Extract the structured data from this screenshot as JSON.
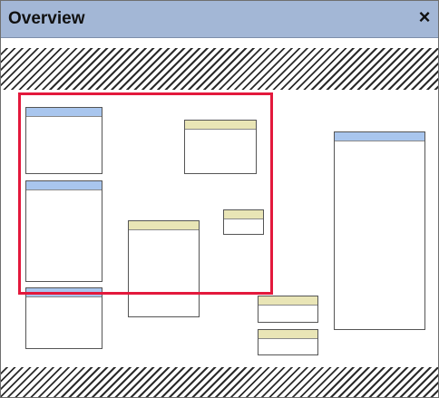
{
  "window": {
    "title": "Overview",
    "close_label": "×"
  },
  "colors": {
    "titlebar": "#a3b7d6",
    "node_header_blue": "#a9c6ee",
    "node_header_yellow": "#e9e5b6",
    "viewport_border": "#e3193c"
  },
  "icons": {
    "close": "close-icon"
  }
}
